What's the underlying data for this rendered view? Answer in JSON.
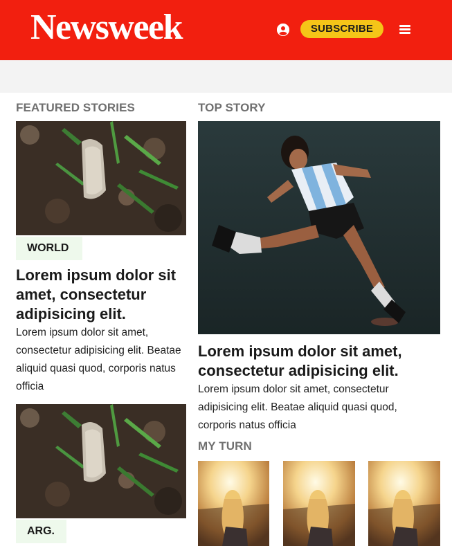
{
  "header": {
    "logo": "Newsweek",
    "subscribe_label": "SUBSCRIBE",
    "user_icon": "user-circle-icon",
    "menu_icon": "hamburger-menu-icon",
    "background_color": "#f21f0f",
    "subscribe_color": "#f5c518"
  },
  "featured": {
    "heading": "FEATURED STORIES",
    "items": [
      {
        "tag": "WORLD",
        "title": "Lorem ipsum dolor sit amet, consectetur adipisicing elit.",
        "body": "Lorem ipsum dolor sit amet, consectetur adipisicing elit. Beatae aliquid quasi quod, corporis natus officia"
      },
      {
        "tag": "ARG."
      }
    ]
  },
  "top_story": {
    "heading": "TOP STORY",
    "title": "Lorem ipsum dolor sit amet, consectetur adipisicing elit.",
    "body": "Lorem ipsum dolor sit amet, consectetur adipisicing elit. Beatae aliquid quasi quod, corporis natus officia"
  },
  "my_turn": {
    "heading": "MY TURN"
  }
}
